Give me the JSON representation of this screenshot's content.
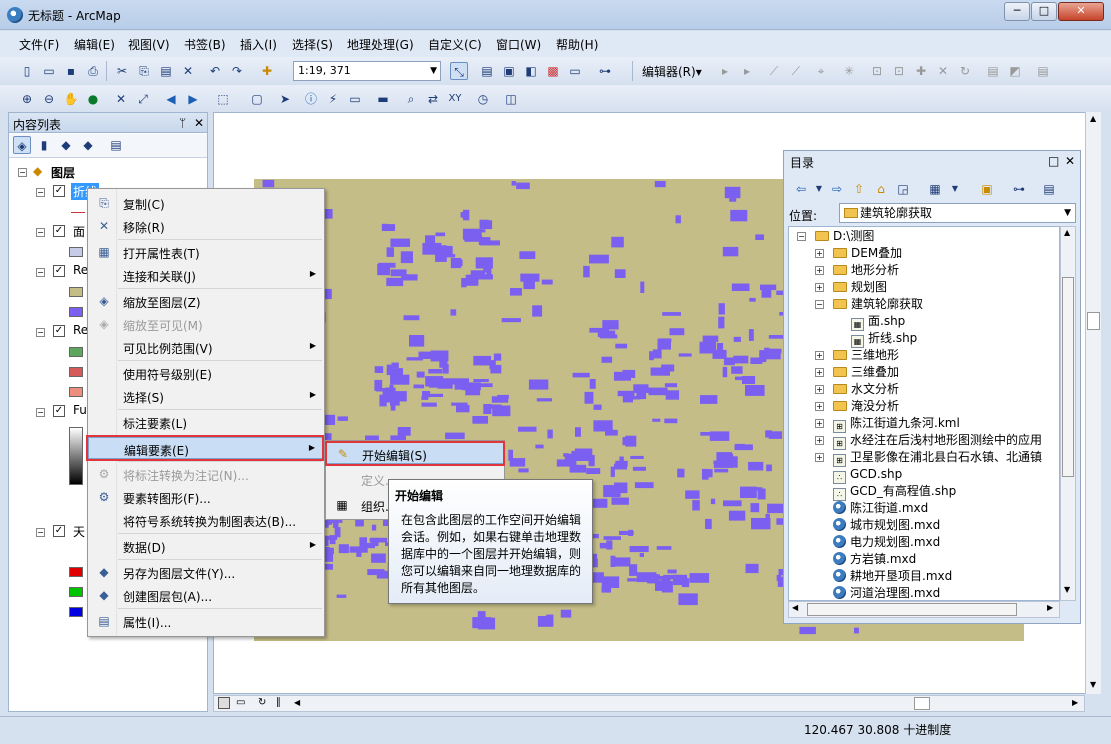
{
  "window": {
    "title": "无标题 - ArcMap",
    "min": "─",
    "max": "□",
    "close": "✕"
  },
  "menu": [
    "文件(F)",
    "编辑(E)",
    "视图(V)",
    "书签(B)",
    "插入(I)",
    "选择(S)",
    "地理处理(G)",
    "自定义(C)",
    "窗口(W)",
    "帮助(H)"
  ],
  "toolbar": {
    "scale": "1:19, 371",
    "editor_label": "编辑器(R)▾"
  },
  "toc": {
    "title": "内容列表",
    "pin": "ᛘ",
    "close": "✕",
    "root": "图层",
    "layers": [
      {
        "label": "折线",
        "checked": true
      },
      {
        "label": "面",
        "checked": true
      },
      {
        "label": "Re",
        "checked": true
      },
      {
        "label": "Re",
        "checked": true
      },
      {
        "label": "Fu",
        "checked": true
      },
      {
        "label": "天",
        "checked": true
      }
    ],
    "swatches": {
      "layer2": "#c7cbe8",
      "layer3a": "#c4bd87",
      "layer3b": "#7b5ff0",
      "layer4a": "#5da75d",
      "layer4b": "#d55a5a",
      "layer4c": "#ec8f7e",
      "layer6a": "#e00000",
      "layer6b": "#00c400",
      "layer6c": "#0000e0"
    }
  },
  "colors": {
    "map_bg": "#c4bd87",
    "buildings": "#7b5ff0"
  },
  "context_menu": [
    {
      "label": "复制(C)",
      "icon": "copy-icon",
      "glyph": "⎘"
    },
    {
      "label": "移除(R)",
      "icon": "remove-icon",
      "glyph": "✕"
    },
    {
      "label": "打开属性表(T)",
      "icon": "table-icon",
      "glyph": "▦"
    },
    {
      "label": "连接和关联(J)",
      "icon": "",
      "glyph": "",
      "submenu": true
    },
    {
      "label": "缩放至图层(Z)",
      "icon": "zoom-layer-icon",
      "glyph": "◈"
    },
    {
      "label": "缩放至可见(M)",
      "icon": "zoom-visible-icon",
      "glyph": "◈",
      "disabled": true
    },
    {
      "label": "可见比例范围(V)",
      "icon": "",
      "glyph": "",
      "submenu": true
    },
    {
      "label": "使用符号级别(E)",
      "icon": "",
      "glyph": ""
    },
    {
      "label": "选择(S)",
      "icon": "",
      "glyph": "",
      "submenu": true
    },
    {
      "label": "标注要素(L)",
      "icon": "",
      "glyph": ""
    },
    {
      "label": "编辑要素(E)",
      "icon": "",
      "glyph": "",
      "submenu": true,
      "highlight": true
    },
    {
      "label": "将标注转换为注记(N)...",
      "icon": "convert-annotation-icon",
      "glyph": "⚙",
      "disabled": true
    },
    {
      "label": "要素转图形(F)...",
      "icon": "feature-graphic-icon",
      "glyph": "⚙"
    },
    {
      "label": "将符号系统转换为制图表达(B)...",
      "icon": "",
      "glyph": ""
    },
    {
      "label": "数据(D)",
      "icon": "",
      "glyph": "",
      "submenu": true
    },
    {
      "label": "另存为图层文件(Y)...",
      "icon": "layer-file-icon",
      "glyph": "◆"
    },
    {
      "label": "创建图层包(A)...",
      "icon": "layer-package-icon",
      "glyph": "◆"
    },
    {
      "label": "属性(I)...",
      "icon": "properties-icon",
      "glyph": "▤"
    }
  ],
  "submenu": [
    {
      "label": "开始编辑(S)",
      "highlight": true
    },
    {
      "label": "定义..."
    },
    {
      "label": "组织..."
    }
  ],
  "tooltip": {
    "title": "开始编辑",
    "body": "在包含此图层的工作空间开始编辑会话。例如，如果右键单击地理数据库中的一个图层并开始编辑，则您可以编辑来自同一地理数据库的所有其他图层。"
  },
  "catalog": {
    "title": "目录",
    "location_label": "位置:",
    "location_value": "建筑轮廓获取",
    "tree": [
      {
        "label": "D:\\测图",
        "type": "folder",
        "indent": 0,
        "expander": "⊟"
      },
      {
        "label": "DEM叠加",
        "type": "folder",
        "indent": 1,
        "expander": "⊞"
      },
      {
        "label": "地形分析",
        "type": "folder",
        "indent": 1,
        "expander": "⊞"
      },
      {
        "label": "规划图",
        "type": "folder",
        "indent": 1,
        "expander": "⊞"
      },
      {
        "label": "建筑轮廓获取",
        "type": "folder",
        "indent": 1,
        "expander": "⊟"
      },
      {
        "label": "面.shp",
        "type": "shp",
        "indent": 2,
        "expander": ""
      },
      {
        "label": "折线.shp",
        "type": "shp",
        "indent": 2,
        "expander": ""
      },
      {
        "label": "三维地形",
        "type": "folder",
        "indent": 1,
        "expander": "⊞"
      },
      {
        "label": "三维叠加",
        "type": "folder",
        "indent": 1,
        "expander": "⊞"
      },
      {
        "label": "水文分析",
        "type": "folder",
        "indent": 1,
        "expander": "⊞"
      },
      {
        "label": "淹没分析",
        "type": "folder",
        "indent": 1,
        "expander": "⊞"
      },
      {
        "label": "陈江街道九条河.kml",
        "type": "kml",
        "indent": 1,
        "expander": "⊞"
      },
      {
        "label": "水经注在后浅村地形图测绘中的应用",
        "type": "kml",
        "indent": 1,
        "expander": "⊞"
      },
      {
        "label": "卫星影像在浦北县白石水镇、北通镇",
        "type": "kml",
        "indent": 1,
        "expander": "⊞"
      },
      {
        "label": "GCD.shp",
        "type": "pt",
        "indent": 1,
        "expander": ""
      },
      {
        "label": "GCD_有高程值.shp",
        "type": "pt",
        "indent": 1,
        "expander": ""
      },
      {
        "label": "陈江街道.mxd",
        "type": "mxd",
        "indent": 1,
        "expander": ""
      },
      {
        "label": "城市规划图.mxd",
        "type": "mxd",
        "indent": 1,
        "expander": ""
      },
      {
        "label": "电力规划图.mxd",
        "type": "mxd",
        "indent": 1,
        "expander": ""
      },
      {
        "label": "方岩镇.mxd",
        "type": "mxd",
        "indent": 1,
        "expander": ""
      },
      {
        "label": "耕地开垦项目.mxd",
        "type": "mxd",
        "indent": 1,
        "expander": ""
      },
      {
        "label": "河道治理图.mxd",
        "type": "mxd",
        "indent": 1,
        "expander": ""
      }
    ]
  },
  "status": {
    "coords": "120.467  30.808 十进制度"
  }
}
